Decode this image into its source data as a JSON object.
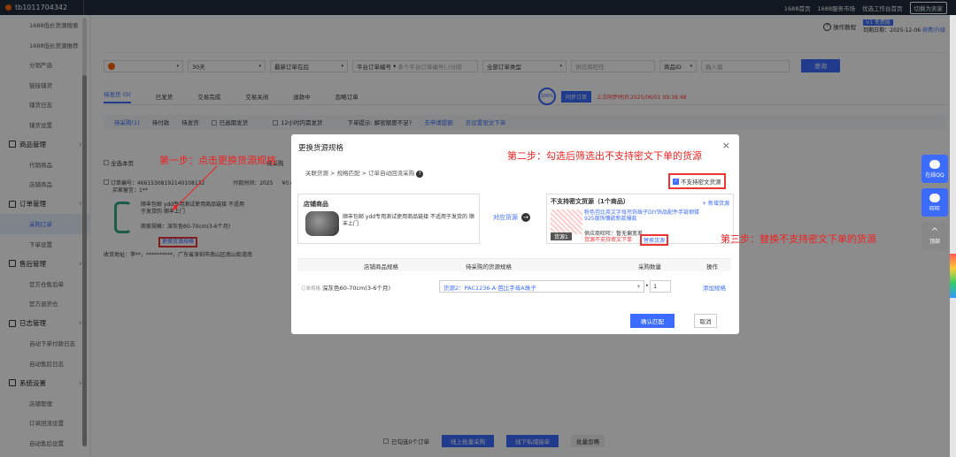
{
  "topbar": {
    "account": "tb1011704342",
    "links": [
      "1688首页",
      "1688服务市场",
      "优选工作台首页"
    ],
    "switch_btn": "切换为卖家"
  },
  "sidebar": {
    "items": [
      {
        "label": "1688低价货源搜索",
        "type": "item"
      },
      {
        "label": "1688低价货源推荐",
        "type": "item"
      },
      {
        "label": "分销严选",
        "type": "item"
      },
      {
        "label": "链接铺货",
        "type": "item"
      },
      {
        "label": "铺货日志",
        "type": "item"
      },
      {
        "label": "铺货设置",
        "type": "item"
      },
      {
        "label": "商品管理",
        "type": "group"
      },
      {
        "label": "代销商品",
        "type": "item"
      },
      {
        "label": "店铺商品",
        "type": "item"
      },
      {
        "label": "订单管理",
        "type": "group"
      },
      {
        "label": "采购订单",
        "type": "item",
        "active": true
      },
      {
        "label": "下单设置",
        "type": "item"
      },
      {
        "label": "售后管理",
        "type": "group"
      },
      {
        "label": "官方仓售后单",
        "type": "item"
      },
      {
        "label": "官方退货仓",
        "type": "item"
      },
      {
        "label": "日志管理",
        "type": "group"
      },
      {
        "label": "自动下单付款日志",
        "type": "item"
      },
      {
        "label": "自动售后日志",
        "type": "item"
      },
      {
        "label": "系统设置",
        "type": "group"
      },
      {
        "label": "店铺管理",
        "type": "item"
      },
      {
        "label": "订单回流设置",
        "type": "item"
      },
      {
        "label": "自动售后设置",
        "type": "item"
      }
    ]
  },
  "header": {
    "tutorial": "操作教程",
    "version_badge": "V1 免费版",
    "expire": "到期日期：2025-12-06",
    "renew": "续费/升级"
  },
  "filters": {
    "days": "30天",
    "sort": "最新订单在后",
    "order_no_type": "平台订单编号",
    "order_no_placeholder": "多个平台订单编号(,)分隔",
    "order_type": "全部订单类型",
    "supplier_placeholder": "供应商旺旺",
    "product_id_type": "商品ID",
    "product_id_placeholder": "输入值",
    "search": "查询"
  },
  "tabs": [
    "待发货 (0)",
    "已发货",
    "交易完成",
    "交易关闭",
    "退款中",
    "忽略订单"
  ],
  "sync": {
    "percent": "100%",
    "button": "同步订单",
    "last_time": "上次同步时间:2025/06/01 09:38:48"
  },
  "subtabs": [
    "待采购(1)",
    "待付款",
    "待发货",
    "已逾期发货",
    "12小时内需发货"
  ],
  "subtabs_hint": "下单提示: 解密额度不足?",
  "subtabs_links": [
    "去申请提额",
    "去设置密文下单"
  ],
  "list": {
    "select_all": "全选本页",
    "order_no": "订单编号：4661530819214010813​2",
    "paytime": "付款时间：2025",
    "buyer_note": "买家留言：1**",
    "product_text": "顺丰包邮 ydd专用测试使用商品链接 不适用于发货的 顺丰上门",
    "spec": "商家规格：深灰色60-70cm(3-6个月)",
    "change_btn": "更换货源规格",
    "address": "收货地址：李**，**********，广东省深圳市南山区南山街道南",
    "pending": "待采购",
    "price": "¥0.0"
  },
  "bottom": {
    "selected": "已勾选0个订单",
    "batch": "线上批量采购",
    "offline": "线下私域接单",
    "ignore": "批量忽略"
  },
  "modal": {
    "title": "更换货源规格",
    "crumb": "关联货源 > 规格匹配 > 订单自动回流采购",
    "shop_title": "店铺商品",
    "shop_text": "顺丰包邮 ydd专用测试使用商品链接 不适用于发货的 顺丰上门",
    "match_label": "对应货源",
    "src_title": "不支持密文货源（1个商品）",
    "src_add": "+ 新增货源",
    "src_desc": "粉色芭比英文字母吊饰珠子DIY饰品配件手链钢镂925银饰镶嵌新款爆款",
    "src_supplier": "供应商旺旺：暂无偏宽差",
    "src_tag": "货源1",
    "src_warn": "货源不支持密文下单",
    "src_replace": "替换货源",
    "filter_label": "不支持密文货源",
    "table_headers": [
      "店铺商品规格",
      "待采购的货源规格",
      "采购数量",
      "操作"
    ],
    "row_spec_label": "订单规格",
    "row_spec": "深灰色60-70cm(3-6个月)",
    "row_source": "货源2：PAC1236-A·芭比字母A珠子",
    "row_qty": "1",
    "row_add": "添加规格",
    "ok": "确认匹配",
    "cancel": "取消"
  },
  "annotations": {
    "step1": "第一步：点击更换货源规格",
    "step2": "第二步：勾选后筛选出不支持密文下单的货源",
    "step3": "第三步：替换不支持密文下单的货源"
  },
  "floats": [
    "在线QQ",
    "旺旺",
    "顶部"
  ],
  "colors": {
    "accent": "#3b6cff",
    "annotation": "#e22222",
    "topbar": "#1f2d3d"
  }
}
